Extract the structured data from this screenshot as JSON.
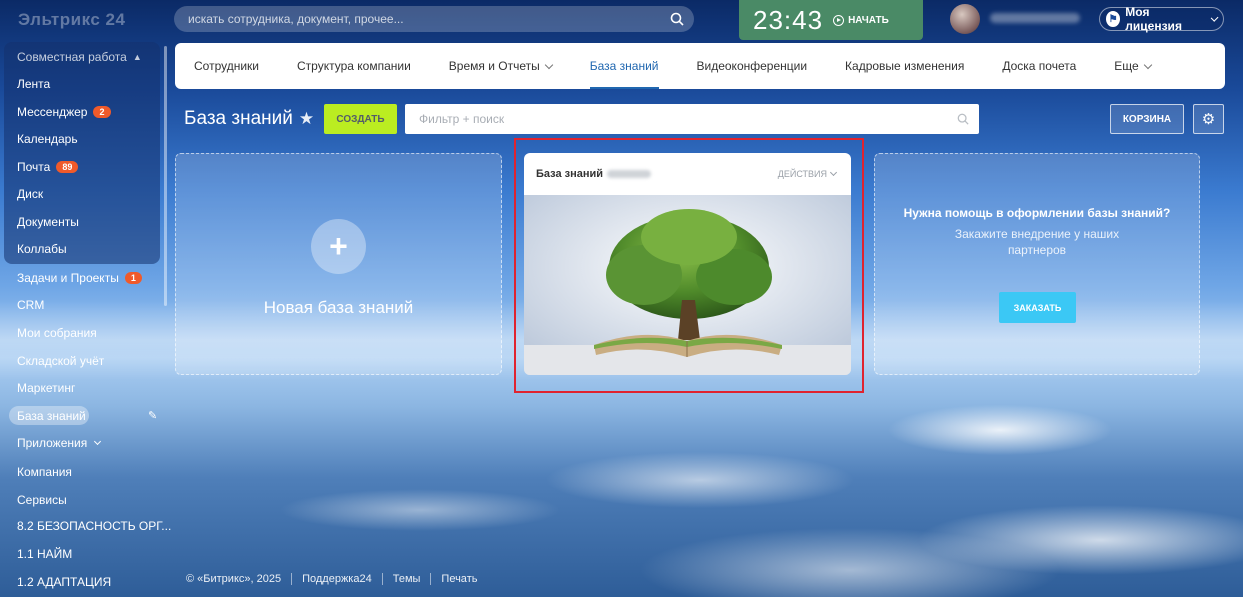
{
  "header": {
    "logo": "Эльтрикс 24",
    "search_placeholder": "искать сотрудника, документ, прочее...",
    "clock_time": "23:43",
    "clock_start": "НАЧАТЬ",
    "license": "Моя лицензия"
  },
  "sidebar": {
    "group_title": "Совместная работа",
    "group_items": [
      {
        "label": "Лента"
      },
      {
        "label": "Мессенджер",
        "badge": "2"
      },
      {
        "label": "Календарь"
      },
      {
        "label": "Почта",
        "badge": "89"
      },
      {
        "label": "Диск"
      },
      {
        "label": "Документы"
      },
      {
        "label": "Коллабы"
      }
    ],
    "items": [
      {
        "label": "Задачи и Проекты",
        "badge": "1"
      },
      {
        "label": "CRM"
      },
      {
        "label": "Мои собрания"
      },
      {
        "label": "Складской учёт"
      },
      {
        "label": "Маркетинг"
      },
      {
        "label": "База знаний",
        "active": true
      },
      {
        "label": "Приложения"
      },
      {
        "label": "Компания"
      },
      {
        "label": "Сервисы"
      },
      {
        "label": "8.2 БЕЗОПАСНОСТЬ ОРГ..."
      },
      {
        "label": "1.1 НАЙМ"
      },
      {
        "label": "1.2 АДАПТАЦИЯ"
      }
    ]
  },
  "nav": {
    "tabs": [
      {
        "label": "Сотрудники"
      },
      {
        "label": "Структура компании"
      },
      {
        "label": "Время и Отчеты"
      },
      {
        "label": "База знаний",
        "active": true
      },
      {
        "label": "Видеоконференции"
      },
      {
        "label": "Кадровые изменения"
      },
      {
        "label": "Доска почета"
      },
      {
        "label": "Еще"
      }
    ]
  },
  "toolbar": {
    "page_title": "База знаний",
    "create_label": "СОЗДАТЬ",
    "filter_placeholder": "Фильтр + поиск",
    "basket_label": "КОРЗИНА"
  },
  "cards": {
    "new_label": "Новая база знаний",
    "kb_title": "База знаний",
    "kb_actions": "ДЕЙСТВИЯ",
    "help_title": "Нужна помощь в оформлении базы знаний?",
    "help_subtitle": "Закажите внедрение у наших партнеров",
    "order_label": "ЗАКАЗАТЬ"
  },
  "footer": {
    "copyright": "© «Битрикс», 2025",
    "support": "Поддержка24",
    "themes": "Темы",
    "print": "Печать"
  },
  "colors": {
    "accent_green": "#bbed21",
    "accent_blue": "#3bc8f5",
    "highlight_red": "#e0232f",
    "badge_orange": "#f05a2a",
    "nav_active": "#2067b0"
  }
}
